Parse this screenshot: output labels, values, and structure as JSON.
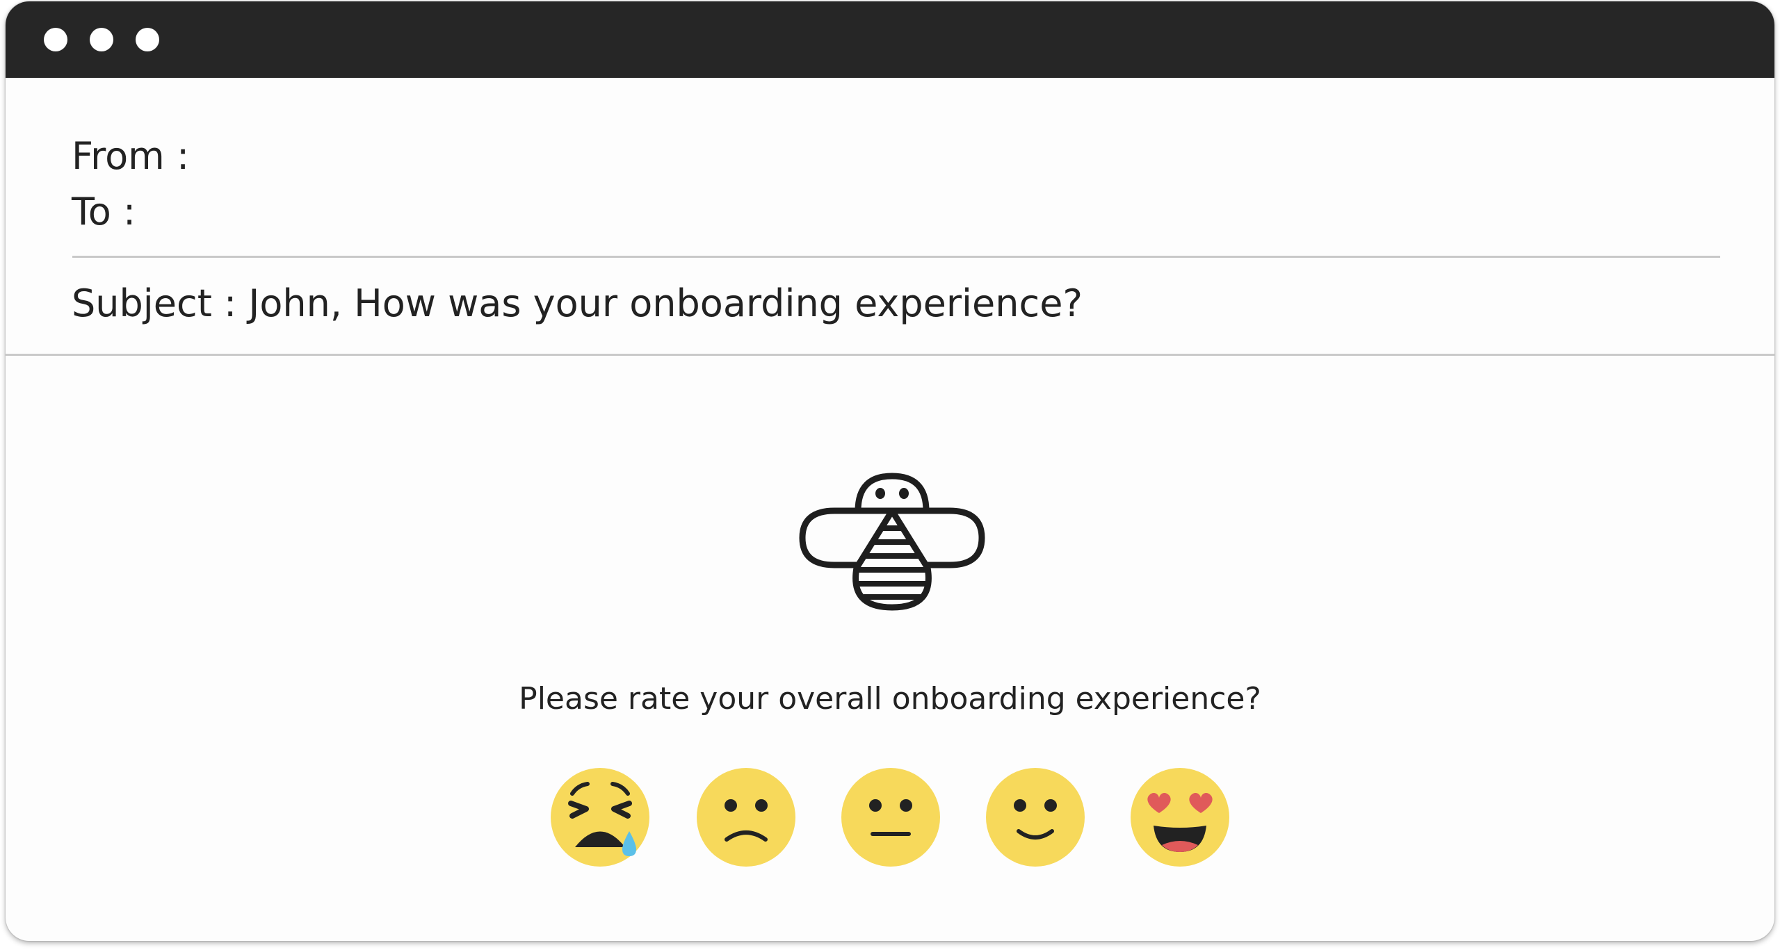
{
  "window": {
    "controls": [
      "window-dot",
      "window-dot",
      "window-dot"
    ]
  },
  "email": {
    "from_label": "From :",
    "to_label": "To :",
    "subject": "Subject : John, How was your onboarding experience?"
  },
  "body": {
    "logo_icon": "bee-icon",
    "question": "Please rate your overall onboarding experience?",
    "ratings": [
      {
        "icon": "crying-face-icon"
      },
      {
        "icon": "frowning-face-icon"
      },
      {
        "icon": "neutral-face-icon"
      },
      {
        "icon": "slightly-smiling-face-icon"
      },
      {
        "icon": "heart-eyes-face-icon"
      }
    ]
  },
  "colors": {
    "titlebar": "#262626",
    "emoji_face": "#F7D95B",
    "heart": "#E05A5A",
    "tear": "#5BC0E8",
    "text": "#222222"
  }
}
